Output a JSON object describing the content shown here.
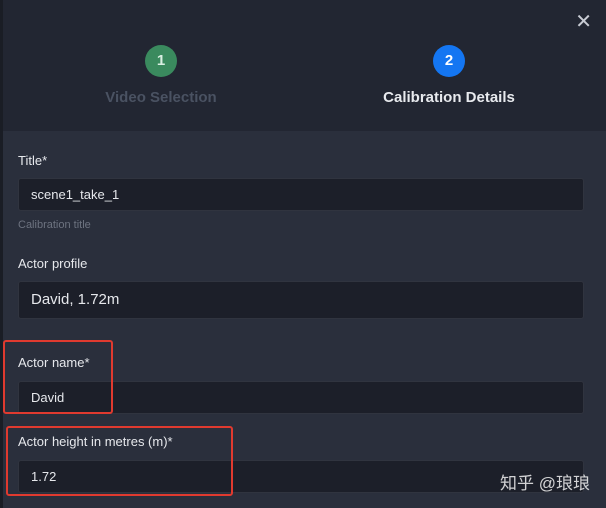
{
  "stepper": {
    "steps": [
      {
        "number": "1",
        "label": "Video Selection"
      },
      {
        "number": "2",
        "label": "Calibration Details"
      }
    ],
    "close_icon": "close-icon"
  },
  "form": {
    "title": {
      "label": "Title*",
      "value": "scene1_take_1",
      "hint": "Calibration title"
    },
    "actor_profile": {
      "label": "Actor profile",
      "value": "David, 1.72m"
    },
    "actor_name": {
      "label": "Actor name*",
      "value": "David"
    },
    "actor_height": {
      "label": "Actor height in metres (m)*",
      "value": "1.72"
    }
  },
  "highlight_color": "#e03a2f",
  "accent_color": "#1476f2",
  "watermark": "知乎 @琅琅"
}
